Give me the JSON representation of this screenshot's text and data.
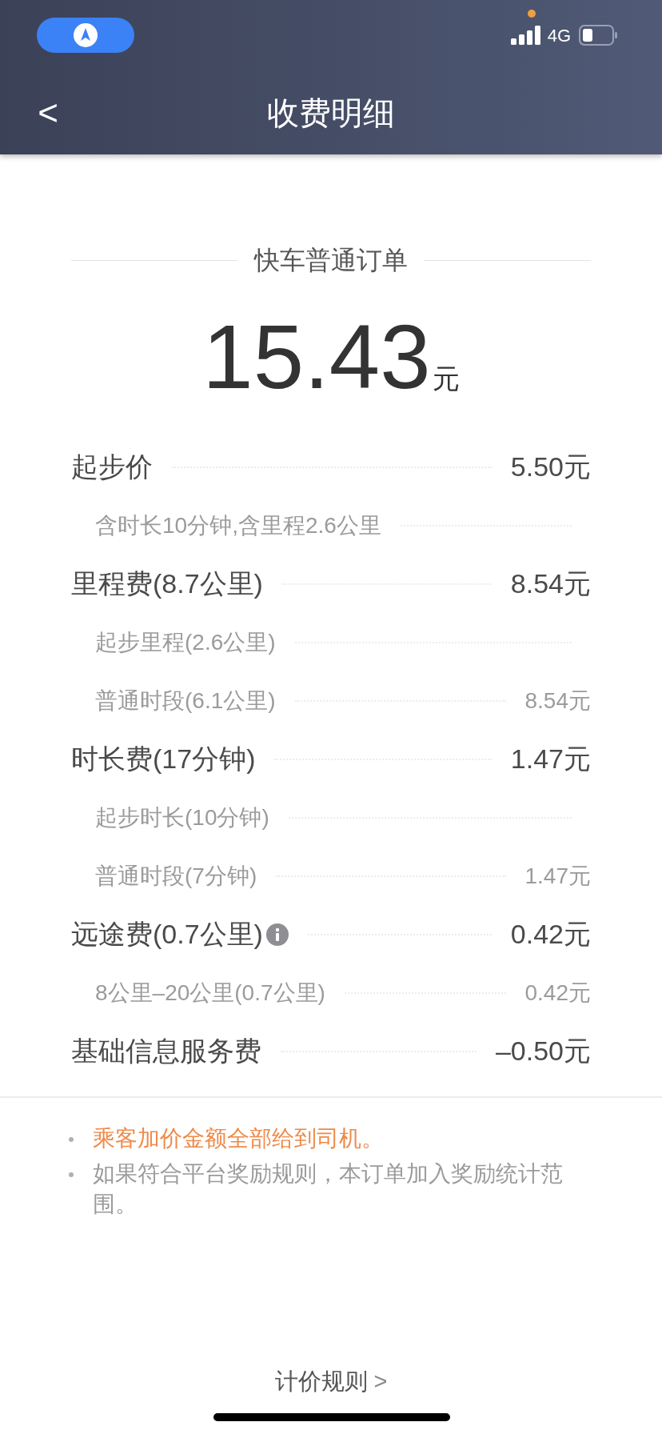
{
  "status_bar": {
    "network": "4G"
  },
  "header": {
    "back": "<",
    "title": "收费明细"
  },
  "order": {
    "type": "快车普通订单",
    "amount": "15.43",
    "unit": "元"
  },
  "rows": [
    {
      "kind": "main",
      "label": "起步价",
      "value": "5.50元",
      "info": false
    },
    {
      "kind": "sub",
      "label": "含时长10分钟,含里程2.6公里",
      "info": false
    },
    {
      "kind": "main",
      "label": "里程费(8.7公里)",
      "value": "8.54元",
      "info": false
    },
    {
      "kind": "sub",
      "label": "起步里程(2.6公里)",
      "info": false
    },
    {
      "kind": "sub",
      "label": "普通时段(6.1公里)",
      "value": "8.54元",
      "info": false
    },
    {
      "kind": "main",
      "label": "时长费(17分钟)",
      "value": "1.47元",
      "info": false
    },
    {
      "kind": "sub",
      "label": "起步时长(10分钟)",
      "info": false
    },
    {
      "kind": "sub",
      "label": "普通时段(7分钟)",
      "value": "1.47元",
      "info": false
    },
    {
      "kind": "main",
      "label": "远途费(0.7公里)",
      "value": "0.42元",
      "info": true
    },
    {
      "kind": "sub",
      "label": "8公里–20公里(0.7公里)",
      "value": "0.42元",
      "info": false
    },
    {
      "kind": "main",
      "label": "基础信息服务费",
      "value": "–0.50元",
      "info": false
    }
  ],
  "notes": [
    {
      "text": "乘客加价金额全部给到司机。",
      "highlight": true
    },
    {
      "text": "如果符合平台奖励规则，本订单加入奖励统计范围。",
      "highlight": false
    }
  ],
  "footer_link": {
    "label": "计价规则",
    "chevron": ">"
  }
}
